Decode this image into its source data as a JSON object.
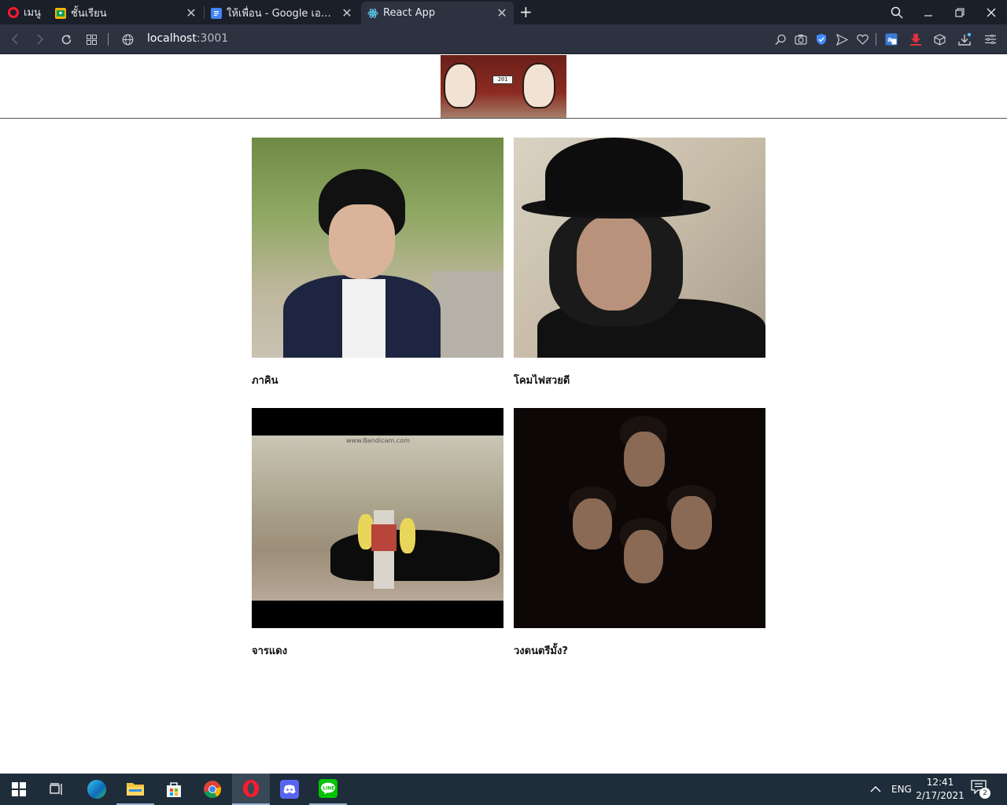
{
  "browser": {
    "menu_label": "เมนู",
    "tabs": [
      {
        "title": "ชั้นเรียน",
        "favicon": "classroom-icon",
        "active": false
      },
      {
        "title": "ให้เพื่อน - Google เอกสาร",
        "favicon": "docs-icon",
        "active": false
      },
      {
        "title": "React App",
        "favicon": "react-icon",
        "active": true
      }
    ],
    "address": {
      "host": "localhost",
      "port": ":3001"
    }
  },
  "page": {
    "cards": [
      {
        "name": "ภาคิน"
      },
      {
        "name": "โคมไฟสวยดี"
      },
      {
        "name": "จารแดง"
      },
      {
        "name": "วงดนตรีมั้ง?"
      }
    ],
    "banner_sign": "201",
    "mv_watermark": "www.Bandicam.com"
  },
  "taskbar": {
    "apps": [
      "start-icon",
      "task-view-icon",
      "edge-icon",
      "file-explorer-icon",
      "store-icon",
      "chrome-icon",
      "opera-icon",
      "discord-icon",
      "line-icon"
    ],
    "language": "ENG",
    "time": "12:41",
    "date": "2/17/2021",
    "notification_count": "2"
  }
}
